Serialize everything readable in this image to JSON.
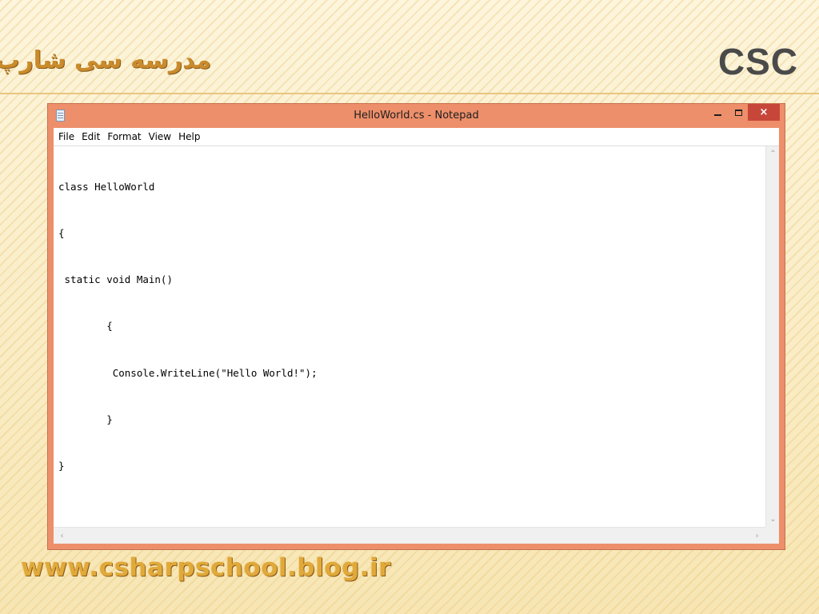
{
  "slide": {
    "persian_title": "مدرسه سی شارپ",
    "brand_abbr": "CSC",
    "footer_url": "www.csharpschool.blog.ir"
  },
  "window": {
    "title": "HelloWorld.cs - Notepad",
    "controls": {
      "minimize": "minimize",
      "maximize": "maximize",
      "close": "×"
    }
  },
  "menu": {
    "items": [
      {
        "label": "File"
      },
      {
        "label": "Edit"
      },
      {
        "label": "Format"
      },
      {
        "label": "View"
      },
      {
        "label": "Help"
      }
    ]
  },
  "editor": {
    "lines": [
      "class HelloWorld",
      "{",
      " static void Main()",
      "        {",
      "         Console.WriteLine(\"Hello World!\");",
      "        }",
      "}"
    ]
  },
  "icons": {
    "app": "notepad-icon",
    "scroll_up": "chevron-up-icon",
    "scroll_down": "chevron-down-icon",
    "scroll_left": "chevron-left-icon",
    "scroll_right": "chevron-right-icon"
  },
  "colors": {
    "window_frame": "#ed8f6a",
    "close_button": "#c7463a",
    "brand_text": "#4a4a4a",
    "title_gold": "#c98b2c"
  }
}
